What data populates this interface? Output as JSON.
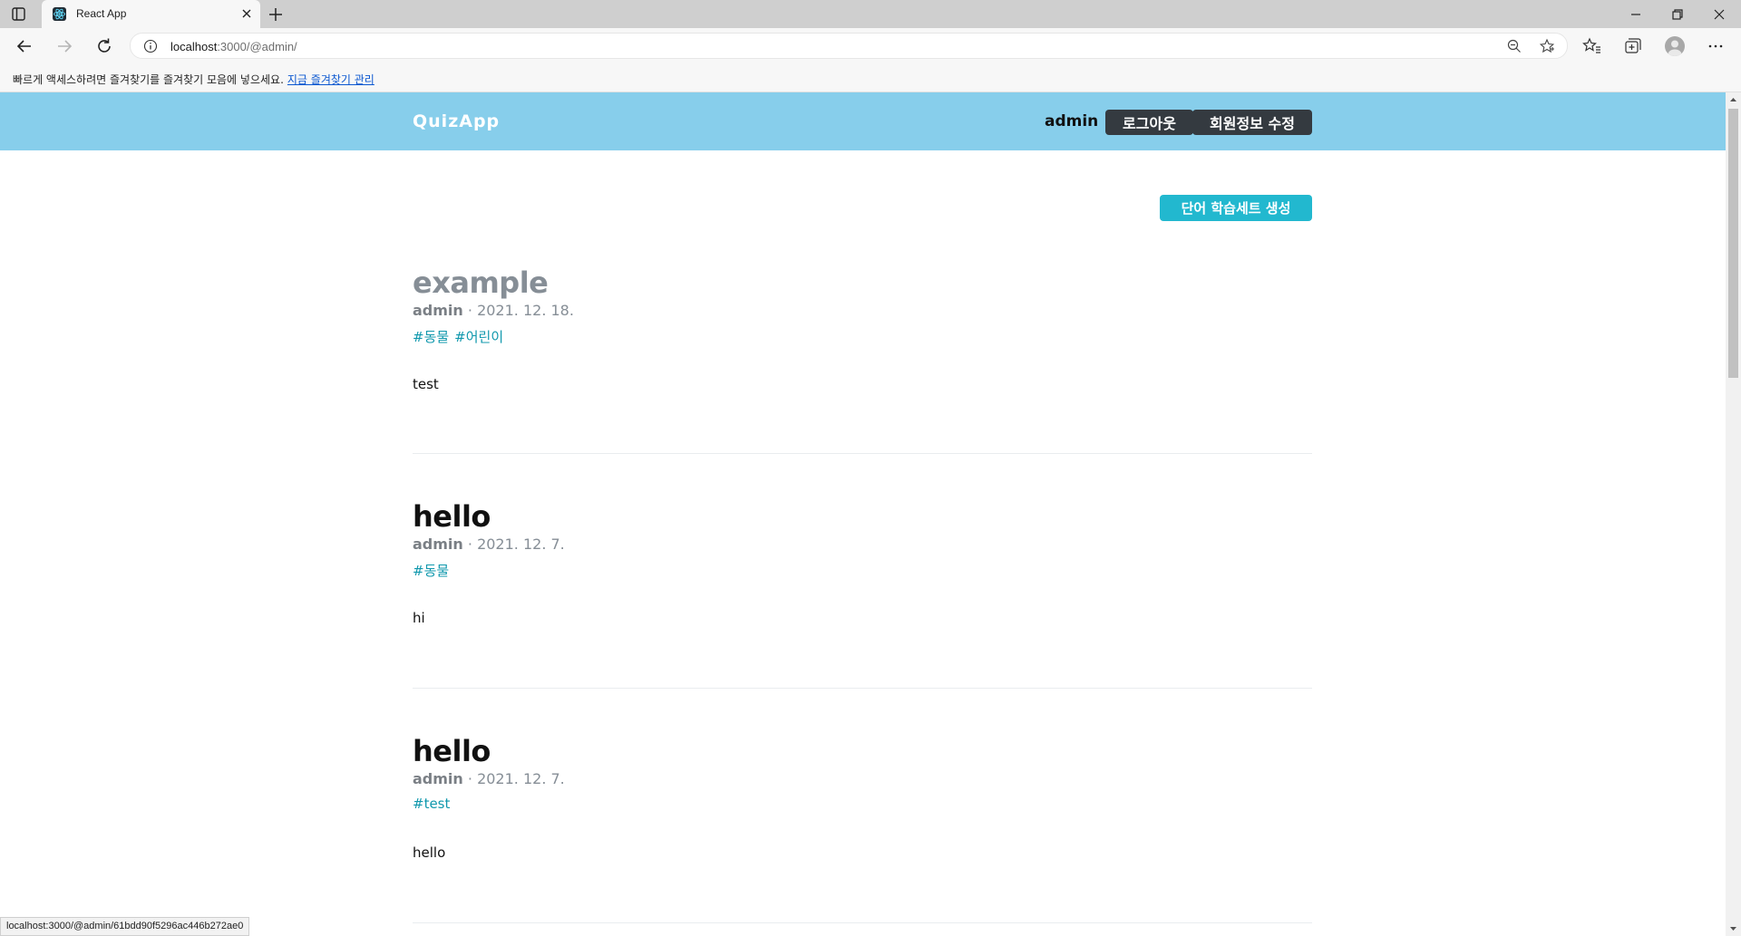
{
  "browser": {
    "tab_title": "React App",
    "url_host": "localhost",
    "url_rest": ":3000/@admin/",
    "favorites_prompt": "빠르게 액세스하려면 즐겨찾기를 즐겨찾기 모음에 넣으세요.",
    "favorites_link": "지금 즐겨찾기 관리",
    "status_url": "localhost:3000/@admin/61bdd90f5296ac446b272ae0"
  },
  "header": {
    "logo": "QuizApp",
    "username": "admin",
    "logout_label": "로그아웃",
    "edit_profile_label": "회원정보 수정",
    "bg_color": "#87ceeb"
  },
  "actions": {
    "create_label": "단어 학습세트 생성",
    "accent": "#22b8cf"
  },
  "posts": [
    {
      "title": "example",
      "author": "admin",
      "date": "2021. 12. 18.",
      "tags": [
        "#동물",
        "#어린이"
      ],
      "body": "test"
    },
    {
      "title": "hello",
      "author": "admin",
      "date": "2021. 12. 7.",
      "tags": [
        "#동물"
      ],
      "body": "hi"
    },
    {
      "title": "hello",
      "author": "admin",
      "date": "2021. 12. 7.",
      "tags": [
        "#test"
      ],
      "body": "hello"
    }
  ],
  "meta_separator": " · "
}
